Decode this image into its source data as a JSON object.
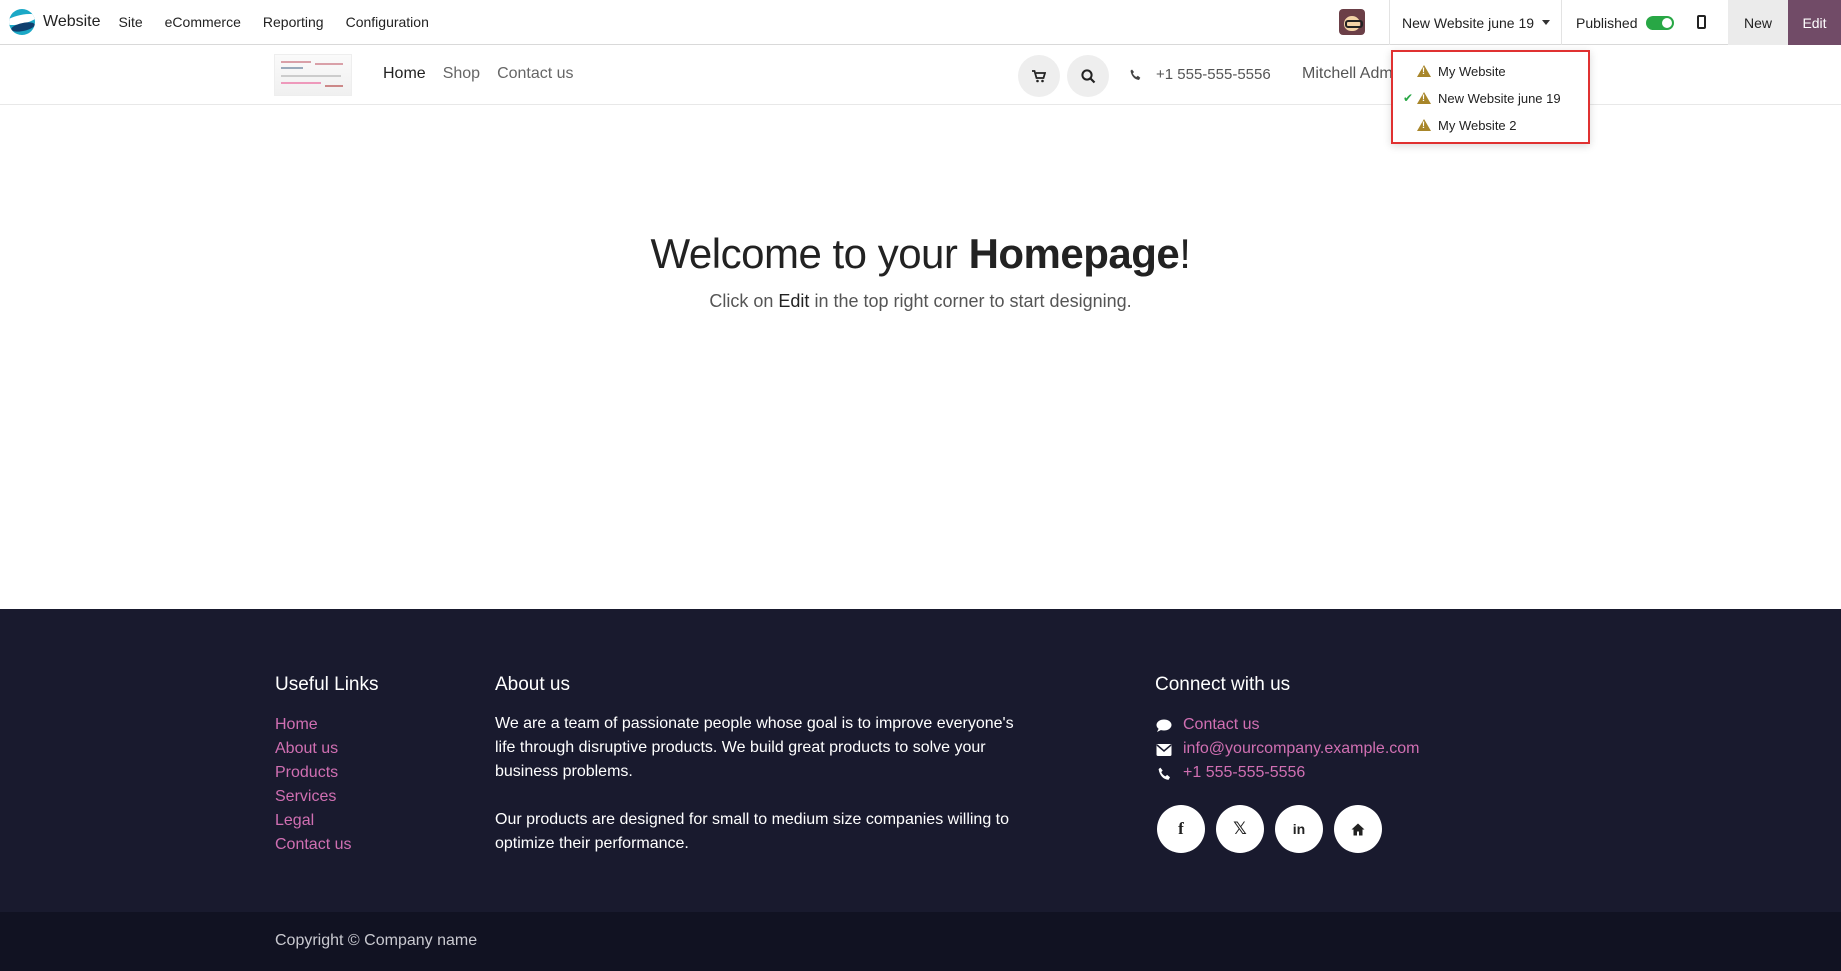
{
  "topbar": {
    "app_name": "Website",
    "menu": [
      "Site",
      "eCommerce",
      "Reporting",
      "Configuration"
    ],
    "current_site": "New Website june 19",
    "published_label": "Published",
    "published": true,
    "new_label": "New",
    "edit_label": "Edit"
  },
  "site_switcher": {
    "items": [
      {
        "label": "My Website",
        "selected": false
      },
      {
        "label": "New Website june 19",
        "selected": true
      },
      {
        "label": "My Website 2",
        "selected": false
      }
    ]
  },
  "sitenav": {
    "links": [
      "Home",
      "Shop",
      "Contact us"
    ],
    "active": "Home",
    "phone": "+1 555-555-5556",
    "user": "Mitchell Admin"
  },
  "hero": {
    "title_prefix": "Welcome to your ",
    "title_bold": "Homepage",
    "title_suffix": "!",
    "sub_prefix": "Click on ",
    "sub_bold": "Edit",
    "sub_suffix": " in the top right corner to start designing."
  },
  "footer": {
    "useful_links_title": "Useful Links",
    "useful_links": [
      "Home",
      "About us",
      "Products",
      "Services",
      "Legal",
      "Contact us"
    ],
    "about_title": "About us",
    "about_p1": "We are a team of passionate people whose goal is to improve everyone's life through disruptive products. We build great products to solve your business problems.",
    "about_p2": "Our products are designed for small to medium size companies willing to optimize their performance.",
    "connect_title": "Connect with us",
    "contact_label": "Contact us",
    "email": "info@yourcompany.example.com",
    "phone": "+1 555-555-5556",
    "social": [
      "facebook-icon",
      "x-icon",
      "linkedin-icon",
      "home-icon"
    ],
    "copyright": "Copyright © Company name"
  },
  "colors": {
    "brand": "#714b67",
    "footer_bg": "#191a2e",
    "link": "#d06fb2",
    "toggle_on": "#28a745",
    "highlight": "#e03131"
  }
}
